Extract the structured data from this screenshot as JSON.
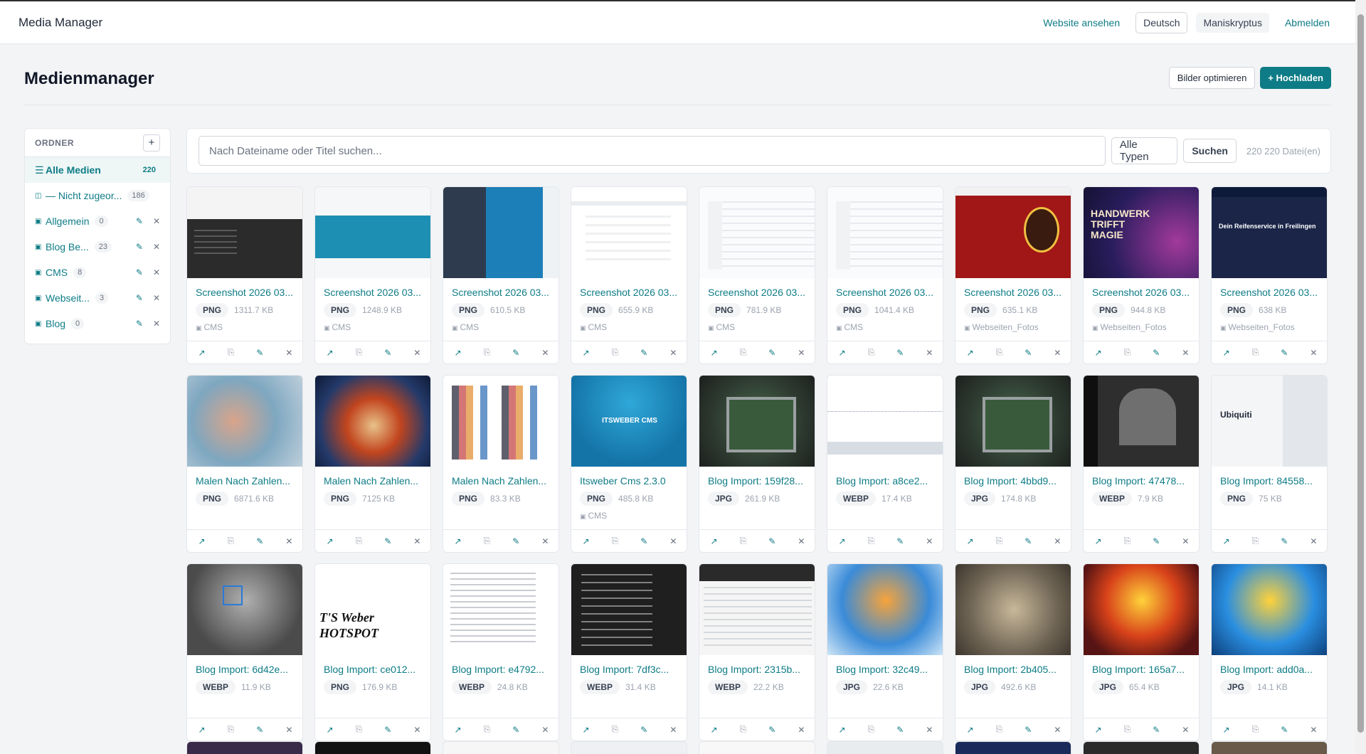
{
  "topbar": {
    "brand": "Media Manager",
    "view_site": "Website ansehen",
    "language": "Deutsch",
    "user": "Maniskryptus",
    "logout": "Abmelden"
  },
  "header": {
    "title": "Medienmanager",
    "optimize_label": "Bilder optimieren",
    "upload_label": "+ Hochladen"
  },
  "sidebar": {
    "heading": "ORDNER",
    "add_symbol": "+",
    "items": [
      {
        "icon": "☰",
        "label": "Alle Medien",
        "count": "220",
        "active": true
      },
      {
        "icon": "◫",
        "label": "— Nicht zugeor...",
        "count": "186"
      },
      {
        "icon": "▣",
        "label": "Allgemein",
        "count": "0",
        "editable": true
      },
      {
        "icon": "▣",
        "label": "Blog Be...",
        "count": "23",
        "editable": true
      },
      {
        "icon": "▣",
        "label": "CMS",
        "count": "8",
        "editable": true
      },
      {
        "icon": "▣",
        "label": "Webseit...",
        "count": "3",
        "editable": true
      },
      {
        "icon": "▣",
        "label": "Blog",
        "count": "0",
        "editable": true
      }
    ]
  },
  "search": {
    "placeholder": "Nach Dateiname oder Titel suchen...",
    "type_filter": "Alle Typen",
    "button": "Suchen",
    "count_text": "220 220 Datei(en)"
  },
  "card_actions": {
    "open": "↗",
    "copy": "⎘",
    "edit": "✎",
    "delete": "✕"
  },
  "media": [
    {
      "title": "Screenshot 2026 03...",
      "type": "PNG",
      "size": "1311.7 KB",
      "folder": "CMS",
      "thumb": "t-dark"
    },
    {
      "title": "Screenshot 2026 03...",
      "type": "PNG",
      "size": "1248.9 KB",
      "folder": "CMS",
      "thumb": "t-cms1"
    },
    {
      "title": "Screenshot 2026 03...",
      "type": "PNG",
      "size": "610.5 KB",
      "folder": "CMS",
      "thumb": "t-cms2"
    },
    {
      "title": "Screenshot 2026 03...",
      "type": "PNG",
      "size": "655.9 KB",
      "folder": "CMS",
      "thumb": "t-white"
    },
    {
      "title": "Screenshot 2026 03...",
      "type": "PNG",
      "size": "781.9 KB",
      "folder": "CMS",
      "thumb": "t-table"
    },
    {
      "title": "Screenshot 2026 03...",
      "type": "PNG",
      "size": "1041.4 KB",
      "folder": "CMS",
      "thumb": "t-table"
    },
    {
      "title": "Screenshot 2026 03...",
      "type": "PNG",
      "size": "635.1 KB",
      "folder": "Webseiten_Fotos",
      "thumb": "t-red"
    },
    {
      "title": "Screenshot 2026 03...",
      "type": "PNG",
      "size": "944.8 KB",
      "folder": "Webseiten_Fotos",
      "thumb": "t-purple"
    },
    {
      "title": "Screenshot 2026 03...",
      "type": "PNG",
      "size": "638 KB",
      "folder": "Webseiten_Fotos",
      "thumb": "t-navy"
    },
    {
      "title": "Malen Nach Zahlen...",
      "type": "PNG",
      "size": "6871.6 KB",
      "folder": "",
      "thumb": "t-paint1"
    },
    {
      "title": "Malen Nach Zahlen...",
      "type": "PNG",
      "size": "7125 KB",
      "folder": "",
      "thumb": "t-paint2"
    },
    {
      "title": "Malen Nach Zahlen...",
      "type": "PNG",
      "size": "83.3 KB",
      "folder": "",
      "thumb": "t-colortbl"
    },
    {
      "title": "Itsweber Cms 2.3.0",
      "type": "PNG",
      "size": "485.8 KB",
      "folder": "CMS",
      "thumb": "t-cmsblue"
    },
    {
      "title": "Blog Import: 159f28...",
      "type": "JPG",
      "size": "261.9 KB",
      "folder": "",
      "thumb": "t-pcb"
    },
    {
      "title": "Blog Import: a8ce2...",
      "type": "WEBP",
      "size": "17.4 KB",
      "folder": "",
      "thumb": "t-chart"
    },
    {
      "title": "Blog Import: 4bbd9...",
      "type": "JPG",
      "size": "174.8 KB",
      "folder": "",
      "thumb": "t-pcb"
    },
    {
      "title": "Blog Import: 47478...",
      "type": "WEBP",
      "size": "7.9 KB",
      "folder": "",
      "thumb": "t-night"
    },
    {
      "title": "Blog Import: 84558...",
      "type": "PNG",
      "size": "75 KB",
      "folder": "",
      "thumb": "t-ubi"
    },
    {
      "title": "Blog Import: 6d42e...",
      "type": "WEBP",
      "size": "11.9 KB",
      "folder": "",
      "thumb": "t-cam"
    },
    {
      "title": "Blog Import: ce012...",
      "type": "PNG",
      "size": "176.9 KB",
      "folder": "",
      "thumb": "t-hotspot"
    },
    {
      "title": "Blog Import: e4792...",
      "type": "WEBP",
      "size": "24.8 KB",
      "folder": "",
      "thumb": "t-code"
    },
    {
      "title": "Blog Import: 7df3c...",
      "type": "WEBP",
      "size": "31.4 KB",
      "folder": "",
      "thumb": "t-editor"
    },
    {
      "title": "Blog Import: 2315b...",
      "type": "WEBP",
      "size": "22.2 KB",
      "folder": "",
      "thumb": "t-term"
    },
    {
      "title": "Blog Import: 32c49...",
      "type": "JPG",
      "size": "22.6 KB",
      "folder": "",
      "thumb": "t-goku1"
    },
    {
      "title": "Blog Import: 2b405...",
      "type": "JPG",
      "size": "492.6 KB",
      "folder": "",
      "thumb": "t-plate"
    },
    {
      "title": "Blog Import: 165a7...",
      "type": "JPG",
      "size": "65.4 KB",
      "folder": "",
      "thumb": "t-dbz"
    },
    {
      "title": "Blog Import: add0a...",
      "type": "JPG",
      "size": "14.1 KB",
      "folder": "",
      "thumb": "t-goku2"
    }
  ],
  "partial_row_colors": [
    "#3a2a4a",
    "#111111",
    "#f6f6f6",
    "#eef0f3",
    "#f8f8f8",
    "#e8ecef",
    "#1a2a5a",
    "#2b2b2b",
    "#6a5a4a"
  ]
}
